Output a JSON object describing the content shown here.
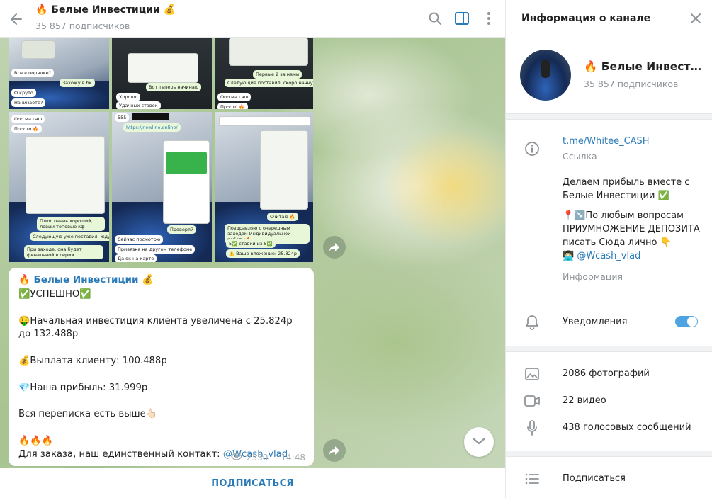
{
  "chat": {
    "title": "🔥 Белые Инвестиции 💰",
    "subscribers": "35 857 подписчиков",
    "photos": {
      "p1": [
        "Все в порядке?",
        "Захожу в бк",
        "О круто",
        "Начинаете?"
      ],
      "p2": [
        "Вот теперь начинаю",
        "Хорошо",
        "Удачных ставок"
      ],
      "p3": [
        "Первые 2 за нами",
        "Следующие поставил, скоро начнут",
        "Ооо ма гаш",
        "Просто 🔥"
      ],
      "p4": [
        "Ооо ма гаш",
        "Просто 🔥",
        "Плюс очень хороший, ловим топовые кф",
        "Следующую уже поставил, жду",
        "При заходе, она будет финальной в серии"
      ],
      "p5": [
        "555",
        "https://newline.online/",
        "Проверяй",
        "Сейчас посмотрю",
        "Привязка на другом телефоне",
        "Да ок на карте"
      ],
      "p6": [
        "Считаю 🔥",
        "Поздравляю с очередным заходом Индивидуальной работы🔥",
        "5✅ ставки из 5✅",
        "⚠️ Ваше вложение: 25.824р"
      ]
    },
    "message": {
      "author": "🔥 Белые Инвестиции 💰",
      "line1": "✅УСПЕШНО✅",
      "line2a": "🤑Начальная инвестиция клиента увеличена с 25.824р",
      "line2b": "до 132.488р",
      "line3": "💰Выплата клиенту: 100.488р",
      "line4": "💎Наша прибыль: 31.999р",
      "line5": "Вся переписка есть выше👆🏻",
      "line6": "🔥🔥🔥",
      "line7_prefix": "Для заказа, наш единственный контакт: ",
      "line7_link": "@Wcash_vlad",
      "views": "2330",
      "time": "14:48"
    },
    "subscribe_label": "ПОДПИСАТЬСЯ"
  },
  "info": {
    "title": "Информация о канале",
    "channel_name": "🔥 Белые Инвестиции 💰",
    "subscribers": "35 857 подписчиков",
    "link": "t.me/Whitee_CASH",
    "link_label": "Ссылка",
    "desc_line1": "Делаем прибыль вместе с",
    "desc_line2": "Белые Инвестиции ✅",
    "desc_line3": "📍↘️По любым вопросам",
    "desc_line4": "ПРИУМНОЖЕНИЕ ДЕПОЗИТА",
    "desc_line5": "писать Сюда лично 👇",
    "desc_line6_emoji": "👨🏻‍💻 ",
    "desc_line6_link": "@Wcash_vlad",
    "desc_label": "Информация",
    "notifications": "Уведомления",
    "notifications_on": true,
    "photos": "2086 фотографий",
    "videos": "22 видео",
    "voice": "438 голосовых сообщений",
    "subscribe": "Подписаться"
  },
  "colors": {
    "accent": "#2a7ab8",
    "toggle": "#4ea4e0",
    "muted": "#8f9499"
  }
}
